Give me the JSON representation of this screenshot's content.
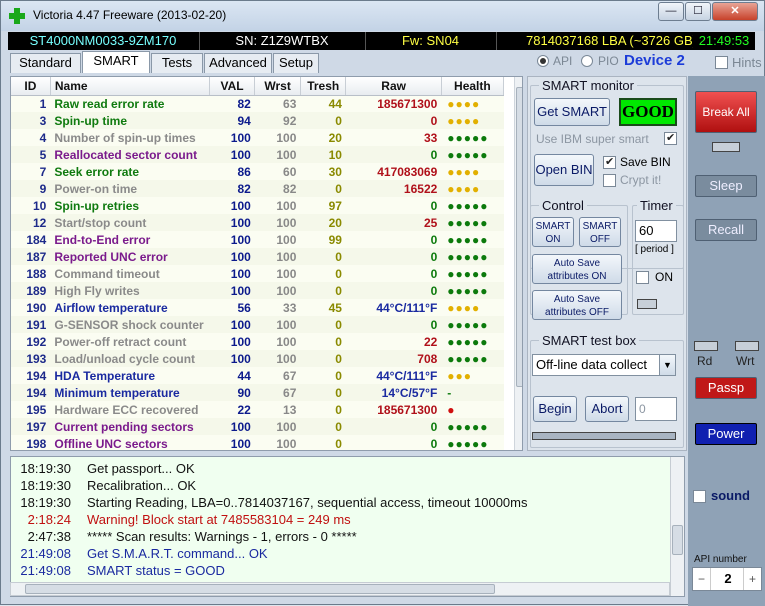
{
  "window": {
    "title": "Victoria 4.47  Freeware (2013-02-20)",
    "minimize": "—",
    "maximize": "☐",
    "close": "✕"
  },
  "info": {
    "model": "ST4000NM0033-9ZM170",
    "serial": "SN: Z1Z9WTBX",
    "firmware": "Fw: SN04",
    "lba": "7814037168 LBA (~3726 GB)",
    "clock": "21:49:53"
  },
  "tabs": [
    "Standard",
    "SMART",
    "Tests",
    "Advanced",
    "Setup"
  ],
  "mode": {
    "api": "API",
    "pio": "PIO",
    "device": "Device 2",
    "hints": "Hints"
  },
  "smart_table": {
    "headers": [
      "ID",
      "Name",
      "VAL",
      "Wrst",
      "Tresh",
      "Raw",
      "Health"
    ],
    "rows": [
      {
        "id": "1",
        "name": "Raw read error rate",
        "val": "82",
        "wrst": "63",
        "tresh": "44",
        "raw": "185671300",
        "health": "●●●●",
        "color": "#0f7a0f",
        "hcolor": "#e2b000",
        "rcolor": "#b0101a"
      },
      {
        "id": "3",
        "name": "Spin-up time",
        "val": "94",
        "wrst": "92",
        "tresh": "0",
        "raw": "0",
        "health": "●●●●",
        "color": "#0f7a0f",
        "hcolor": "#e2b000",
        "rcolor": "#b0101a"
      },
      {
        "id": "4",
        "name": "Number of spin-up times",
        "val": "100",
        "wrst": "100",
        "tresh": "20",
        "raw": "33",
        "health": "●●●●●",
        "color": "#8a8a8a",
        "hcolor": "#0c7a0c",
        "rcolor": "#b0101a"
      },
      {
        "id": "5",
        "name": "Reallocated sector count",
        "val": "100",
        "wrst": "100",
        "tresh": "10",
        "raw": "0",
        "health": "●●●●●",
        "color": "#7a1a8c",
        "hcolor": "#0c7a0c",
        "rcolor": "#0c7a0c"
      },
      {
        "id": "7",
        "name": "Seek error rate",
        "val": "86",
        "wrst": "60",
        "tresh": "30",
        "raw": "417083069",
        "health": "●●●●",
        "color": "#0f7a0f",
        "hcolor": "#e2b000",
        "rcolor": "#b0101a"
      },
      {
        "id": "9",
        "name": "Power-on time",
        "val": "82",
        "wrst": "82",
        "tresh": "0",
        "raw": "16522",
        "health": "●●●●",
        "color": "#8a8a8a",
        "hcolor": "#e2b000",
        "rcolor": "#b0101a"
      },
      {
        "id": "10",
        "name": "Spin-up retries",
        "val": "100",
        "wrst": "100",
        "tresh": "97",
        "raw": "0",
        "health": "●●●●●",
        "color": "#0f7a0f",
        "hcolor": "#0c7a0c",
        "rcolor": "#0c7a0c"
      },
      {
        "id": "12",
        "name": "Start/stop count",
        "val": "100",
        "wrst": "100",
        "tresh": "20",
        "raw": "25",
        "health": "●●●●●",
        "color": "#8a8a8a",
        "hcolor": "#0c7a0c",
        "rcolor": "#b0101a"
      },
      {
        "id": "184",
        "name": "End-to-End error",
        "val": "100",
        "wrst": "100",
        "tresh": "99",
        "raw": "0",
        "health": "●●●●●",
        "color": "#7a1a8c",
        "hcolor": "#0c7a0c",
        "rcolor": "#0c7a0c"
      },
      {
        "id": "187",
        "name": "Reported UNC error",
        "val": "100",
        "wrst": "100",
        "tresh": "0",
        "raw": "0",
        "health": "●●●●●",
        "color": "#7a1a8c",
        "hcolor": "#0c7a0c",
        "rcolor": "#0c7a0c"
      },
      {
        "id": "188",
        "name": "Command timeout",
        "val": "100",
        "wrst": "100",
        "tresh": "0",
        "raw": "0",
        "health": "●●●●●",
        "color": "#8a8a8a",
        "hcolor": "#0c7a0c",
        "rcolor": "#0c7a0c"
      },
      {
        "id": "189",
        "name": "High Fly writes",
        "val": "100",
        "wrst": "100",
        "tresh": "0",
        "raw": "0",
        "health": "●●●●●",
        "color": "#8a8a8a",
        "hcolor": "#0c7a0c",
        "rcolor": "#0c7a0c"
      },
      {
        "id": "190",
        "name": "Airflow temperature",
        "val": "56",
        "wrst": "33",
        "tresh": "45",
        "raw": "44°C/111°F",
        "health": "●●●●",
        "color": "#1a2aa0",
        "hcolor": "#e2b000",
        "rcolor": "#1a2aa0"
      },
      {
        "id": "191",
        "name": "G-SENSOR shock counter",
        "val": "100",
        "wrst": "100",
        "tresh": "0",
        "raw": "0",
        "health": "●●●●●",
        "color": "#8a8a8a",
        "hcolor": "#0c7a0c",
        "rcolor": "#0c7a0c"
      },
      {
        "id": "192",
        "name": "Power-off retract count",
        "val": "100",
        "wrst": "100",
        "tresh": "0",
        "raw": "22",
        "health": "●●●●●",
        "color": "#8a8a8a",
        "hcolor": "#0c7a0c",
        "rcolor": "#b0101a"
      },
      {
        "id": "193",
        "name": "Load/unload cycle count",
        "val": "100",
        "wrst": "100",
        "tresh": "0",
        "raw": "708",
        "health": "●●●●●",
        "color": "#8a8a8a",
        "hcolor": "#0c7a0c",
        "rcolor": "#b0101a"
      },
      {
        "id": "194",
        "name": "HDA Temperature",
        "val": "44",
        "wrst": "67",
        "tresh": "0",
        "raw": "44°C/111°F",
        "health": "●●●",
        "color": "#1a2aa0",
        "hcolor": "#e2b000",
        "rcolor": "#1a2aa0"
      },
      {
        "id": "194",
        "name": "Minimum temperature",
        "val": "90",
        "wrst": "67",
        "tresh": "0",
        "raw": "14°C/57°F",
        "health": "-",
        "color": "#1a2aa0",
        "hcolor": "#0c7a0c",
        "rcolor": "#1a2aa0"
      },
      {
        "id": "195",
        "name": "Hardware ECC recovered",
        "val": "22",
        "wrst": "13",
        "tresh": "0",
        "raw": "185671300",
        "health": "●",
        "color": "#8a8a8a",
        "hcolor": "#d01010",
        "rcolor": "#b0101a"
      },
      {
        "id": "197",
        "name": "Current pending sectors",
        "val": "100",
        "wrst": "100",
        "tresh": "0",
        "raw": "0",
        "health": "●●●●●",
        "color": "#7a1a8c",
        "hcolor": "#0c7a0c",
        "rcolor": "#0c7a0c"
      },
      {
        "id": "198",
        "name": "Offline UNC sectors",
        "val": "100",
        "wrst": "100",
        "tresh": "0",
        "raw": "0",
        "health": "●●●●●",
        "color": "#7a1a8c",
        "hcolor": "#0c7a0c",
        "rcolor": "#0c7a0c"
      }
    ]
  },
  "smart_monitor": {
    "title": "SMART monitor",
    "get_smart": "Get SMART",
    "status": "GOOD",
    "ibm_label": "Use IBM super smart",
    "open_bin": "Open BIN",
    "save_bin": "Save BIN",
    "crypt": "Crypt it!"
  },
  "control": {
    "title": "Control",
    "smart_on": "SMART\nON",
    "smart_off": "SMART\nOFF",
    "autosave_on": "Auto Save\nattributes ON",
    "autosave_off": "Auto Save\nattributes OFF"
  },
  "timer": {
    "title": "Timer",
    "value": "60",
    "period": "[ period ]",
    "on_label": "ON"
  },
  "test_box": {
    "title": "SMART test box",
    "selected": "Off-line data collect",
    "begin": "Begin",
    "abort": "Abort",
    "field": "0"
  },
  "right": {
    "break_all": "Break All",
    "sleep": "Sleep",
    "recall": "Recall",
    "rd": "Rd",
    "wrt": "Wrt",
    "passp": "Passp",
    "power": "Power",
    "sound": "sound",
    "api_number_label": "API number",
    "api_number": "2",
    "minus": "−",
    "plus": "+"
  },
  "log": [
    {
      "time": "18:19:30",
      "msg": "Get passport... OK",
      "color": "#111111"
    },
    {
      "time": "18:19:30",
      "msg": "Recalibration... OK",
      "color": "#111111"
    },
    {
      "time": "18:19:30",
      "msg": "Starting Reading, LBA=0..7814037167, sequential access, timeout 10000ms",
      "color": "#111111"
    },
    {
      "time": "2:18:24",
      "msg": "Warning! Block start at 7485583104 = 249 ms",
      "color": "#c01010"
    },
    {
      "time": "2:47:38",
      "msg": "***** Scan results: Warnings - 1, errors - 0 *****",
      "color": "#111111"
    },
    {
      "time": "21:49:08",
      "msg": "Get S.M.A.R.T. command... OK",
      "color": "#1a2aa0"
    },
    {
      "time": "21:49:08",
      "msg": "SMART status = GOOD",
      "color": "#1a2aa0"
    }
  ]
}
